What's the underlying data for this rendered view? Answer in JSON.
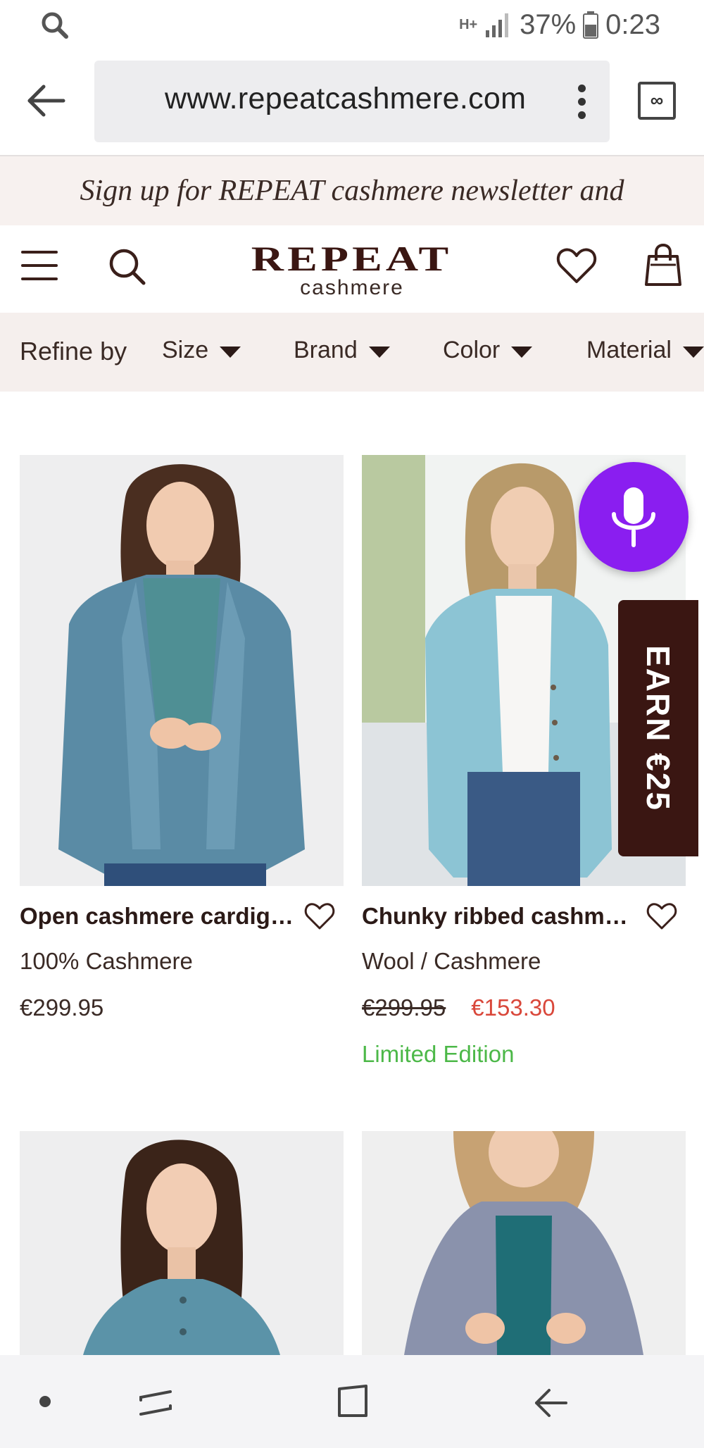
{
  "status_bar": {
    "network": "H+",
    "battery": "37%",
    "time": "0:23"
  },
  "browser": {
    "url": "www.repeatcashmere.com",
    "tabs_label": "∞"
  },
  "promo": {
    "text": "Sign up for REPEAT cashmere newsletter and"
  },
  "header": {
    "logo_main": "REPEAT",
    "logo_sub": "cashmere"
  },
  "refine": {
    "label": "Refine by",
    "filters": [
      "Size",
      "Brand",
      "Color",
      "Material"
    ]
  },
  "products": [
    {
      "name": "Open cashmere cardiga...",
      "material": "100% Cashmere",
      "price": "€299.95"
    },
    {
      "name": "Chunky ribbed cashmer...",
      "material": "Wool / Cashmere",
      "old_price": "€299.95",
      "sale_price": "€153.30",
      "tag": "Limited Edition"
    }
  ],
  "earn": {
    "label": "EARN €25"
  },
  "colors": {
    "brand": "#3a1612",
    "sale": "#d9473a",
    "limited": "#4cb848",
    "mic": "#8a1ef0"
  }
}
